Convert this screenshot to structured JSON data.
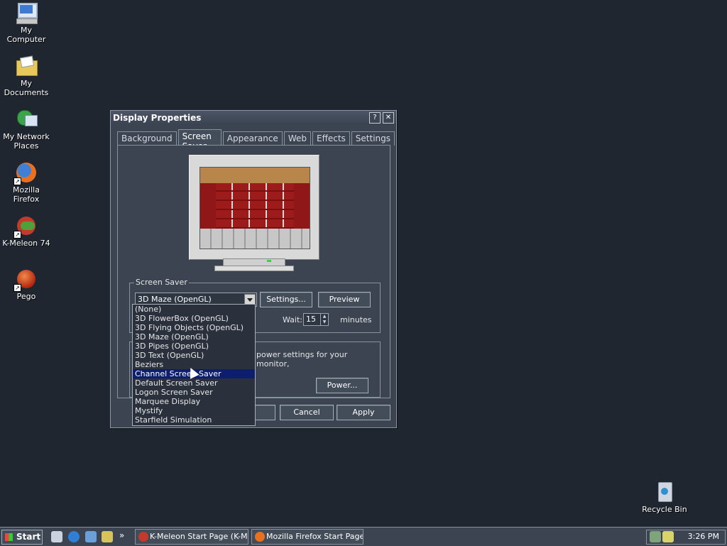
{
  "desktop": {
    "icons": [
      {
        "label": "My Computer"
      },
      {
        "label": "My Documents"
      },
      {
        "label": "My Network Places"
      },
      {
        "label": "Mozilla Firefox"
      },
      {
        "label": "K-Meleon 74"
      },
      {
        "label": "Pego"
      },
      {
        "label": "Recycle Bin"
      }
    ]
  },
  "dialog": {
    "title": "Display Properties",
    "help_button": "?",
    "close_button": "✕",
    "tabs": [
      {
        "label": "Background"
      },
      {
        "label": "Screen Saver",
        "active": true
      },
      {
        "label": "Appearance"
      },
      {
        "label": "Web"
      },
      {
        "label": "Effects"
      },
      {
        "label": "Settings"
      }
    ],
    "screen_saver_group": {
      "label": "Screen Saver",
      "selected": "3D Maze (OpenGL)",
      "settings_button": "Settings...",
      "preview_button": "Preview",
      "wait_label": "Wait:",
      "wait_value": "15",
      "wait_unit": "minutes"
    },
    "power_group": {
      "text": "power settings for your monitor,",
      "power_button": "Power..."
    },
    "bottom_buttons": {
      "cancel": "Cancel",
      "apply": "Apply"
    },
    "dropdown_options": [
      "(None)",
      "3D FlowerBox (OpenGL)",
      "3D Flying Objects (OpenGL)",
      "3D Maze (OpenGL)",
      "3D Pipes (OpenGL)",
      "3D Text (OpenGL)",
      "Beziers",
      "Channel Screen Saver",
      "Default Screen Saver",
      "Logon Screen Saver",
      "Marquee Display",
      "Mystify",
      "Starfield Simulation"
    ],
    "highlighted_option": "Channel Screen Saver"
  },
  "taskbar": {
    "start_label": "Start",
    "chevron": "»",
    "tasks": [
      {
        "label": "K-Meleon Start Page (K-M..."
      },
      {
        "label": "Mozilla Firefox Start Page..."
      }
    ],
    "clock": "3:26 PM"
  },
  "colors": {
    "desktop": "#1f2630",
    "window": "#3b4450",
    "highlight": "#0d1e6e"
  }
}
